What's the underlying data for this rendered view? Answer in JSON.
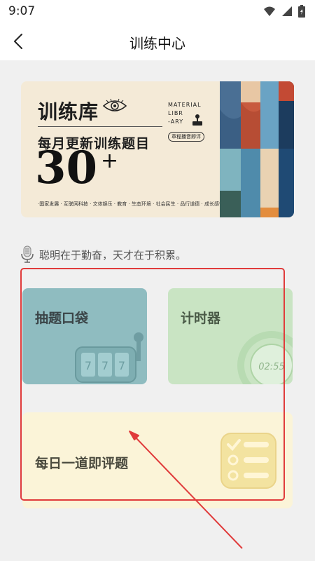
{
  "status_bar": {
    "time": "9:07"
  },
  "app_bar": {
    "title": "训练中心"
  },
  "banner": {
    "title": "训练库",
    "subtitle": "每月更新训练题目",
    "count": "30",
    "count_suffix": "+",
    "material_text": "MATERIAL\nLIBR\n-ARY",
    "stamp_text": "章程播音即评",
    "tags": "·国家发展 · 互联网科技 · 文体娱乐 · 教育 · 生态环境 · 社会民生 · 品行道德 · 成长感悟·"
  },
  "quote": {
    "text": "聪明在于勤奋，天才在于积累。"
  },
  "cards": [
    {
      "label": "抽题口袋",
      "icon": "slot-machine-icon"
    },
    {
      "label": "计时器",
      "icon": "clock-icon",
      "clock_text": "02:55"
    },
    {
      "label": "每日一道即评题",
      "icon": "checklist-icon"
    }
  ],
  "colors": {
    "banner_bg": "#f4ead7",
    "card1_bg": "#8fbcc0",
    "card2_bg": "#c9e4c3",
    "card3_bg": "#fbf4d8",
    "annotation_red": "#e03b3b"
  }
}
